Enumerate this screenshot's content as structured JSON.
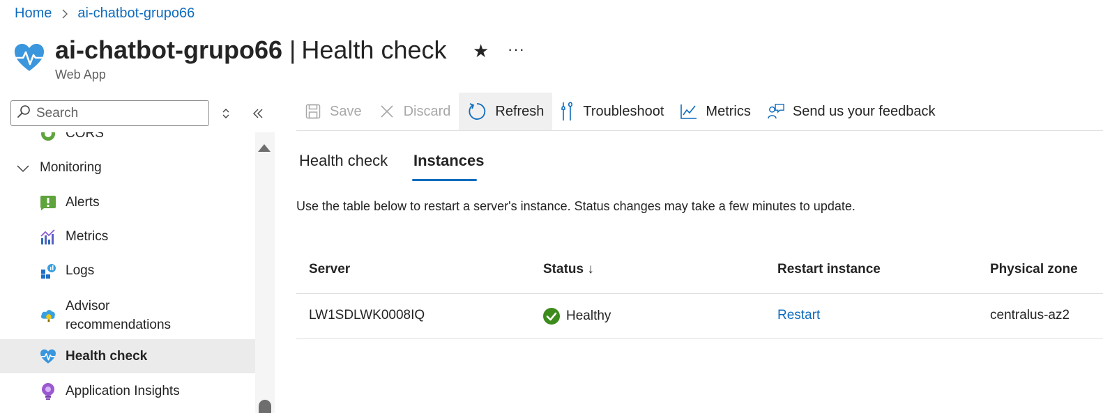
{
  "breadcrumb": {
    "items": [
      "Home",
      "ai-chatbot-grupo66"
    ]
  },
  "header": {
    "resource_name": "ai-chatbot-grupo66",
    "separator": "|",
    "page_name": "Health check",
    "subtitle": "Web App",
    "favorite_icon": "★",
    "more_icon": "···"
  },
  "sidebar": {
    "search_placeholder": "Search",
    "items": [
      {
        "label": "CORS",
        "icon": "cors-icon"
      },
      {
        "label": "Monitoring",
        "icon": "chevron-down-icon"
      },
      {
        "label": "Alerts",
        "icon": "alerts-icon"
      },
      {
        "label": "Metrics",
        "icon": "metrics-icon"
      },
      {
        "label": "Logs",
        "icon": "logs-icon"
      },
      {
        "label": "Advisor",
        "label2": "recommendations",
        "icon": "advisor-icon"
      },
      {
        "label": "Health check",
        "icon": "heart-icon",
        "active": true
      },
      {
        "label": "Application Insights",
        "icon": "insights-icon"
      }
    ]
  },
  "toolbar": {
    "save": "Save",
    "discard": "Discard",
    "refresh": "Refresh",
    "troubleshoot": "Troubleshoot",
    "metrics": "Metrics",
    "feedback": "Send us your feedback"
  },
  "tabs": [
    {
      "label": "Health check",
      "selected": false
    },
    {
      "label": "Instances",
      "selected": true
    }
  ],
  "description": "Use the table below to restart a server's instance. Status changes may take a few minutes to update.",
  "table": {
    "columns": [
      "Server",
      "Status ↓",
      "Restart instance",
      "Physical zone"
    ],
    "rows": [
      {
        "server": "LW1SDLWK0008IQ",
        "status": "Healthy",
        "action": "Restart",
        "zone": "centralus-az2"
      }
    ]
  },
  "colors": {
    "accent": "#0f6cbd",
    "healthy": "#107c10",
    "active_nav_bg": "#ebebeb"
  }
}
